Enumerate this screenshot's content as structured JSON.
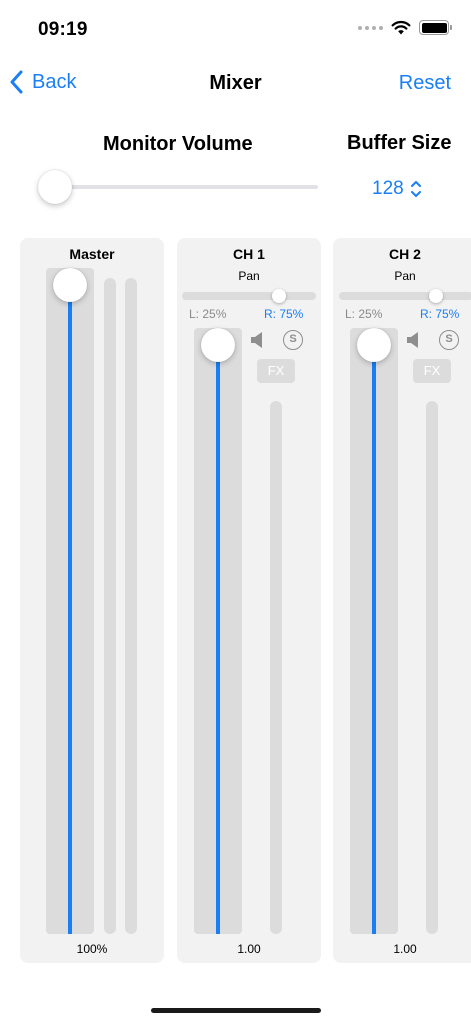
{
  "status_bar": {
    "time": "09:19",
    "icons": [
      "signal-dots-icon",
      "wifi-icon",
      "battery-icon"
    ]
  },
  "nav": {
    "back_label": "Back",
    "title": "Mixer",
    "reset_label": "Reset",
    "back_icon": "chevron-left-icon"
  },
  "monitor": {
    "label": "Monitor Volume",
    "value": 0.0
  },
  "buffer": {
    "label": "Buffer Size",
    "value": "128",
    "icon": "up-down-chevron-icon"
  },
  "master": {
    "title": "Master",
    "level": 1.0,
    "value_text": "100%"
  },
  "channels": [
    {
      "title": "CH 1",
      "pan_label": "Pan",
      "pan": 0.75,
      "left_text": "L: 25%",
      "right_text": "R: 75%",
      "fx_label": "FX",
      "solo_label": "S",
      "level": 1.0,
      "value_text": "1.00"
    },
    {
      "title": "CH 2",
      "pan_label": "Pan",
      "pan": 0.75,
      "left_text": "L: 25%",
      "right_text": "R: 75%",
      "fx_label": "FX",
      "solo_label": "S",
      "level": 1.0,
      "value_text": "1.00"
    }
  ],
  "colors": {
    "accent": "#1a7ff5",
    "panel": "#f2f2f2",
    "track": "#dcdcdc"
  }
}
